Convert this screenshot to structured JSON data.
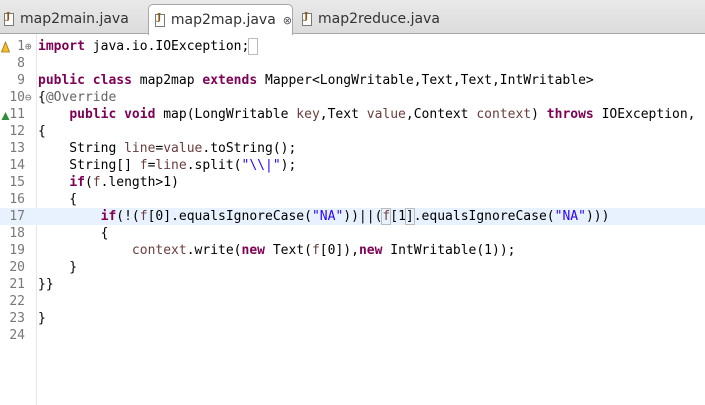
{
  "tabs": [
    {
      "label": "map2main.java",
      "active": false
    },
    {
      "label": "map2map.java",
      "active": true,
      "close": "⊗"
    },
    {
      "label": "map2reduce.java",
      "active": false
    }
  ],
  "lines": [
    {
      "num": "1",
      "fold": "⊕",
      "html": "<span class='kw'>import</span> java.io.IOException;<span class='caretbox'> </span>"
    },
    {
      "num": "8",
      "html": ""
    },
    {
      "num": "9",
      "html": "<span class='kw'>public class</span> map2map <span class='kw'>extends</span> Mapper&lt;LongWritable,Text,Text,IntWritable&gt;"
    },
    {
      "num": "10",
      "fold": "⊖",
      "html": "{<span class='ann'>@Override</span>"
    },
    {
      "num": "11",
      "html": "    <span class='kw'>public void</span> map(LongWritable <span class='fld'>key</span>,Text <span class='fld'>value</span>,Context <span class='fld'>context</span>) <span class='kw'>throws</span> IOException,"
    },
    {
      "num": "12",
      "html": "{"
    },
    {
      "num": "13",
      "html": "    String <span class='fld'>line</span>=<span class='fld'>value</span>.toString();"
    },
    {
      "num": "14",
      "html": "    String[] <span class='fld'>f</span>=<span class='fld'>line</span>.split(<span class='str'>\"\\\\|\"</span>);"
    },
    {
      "num": "15",
      "html": "    <span class='kw'>if</span>(<span class='fld'>f</span>.length&gt;1)"
    },
    {
      "num": "16",
      "html": "    {"
    },
    {
      "num": "17",
      "hl": true,
      "html": "        <span class='kw'>if</span>(!(<span class='fld'>f</span>[0].equalsIgnoreCase(<span class='str'>\"NA\"</span>))||(<span class='fld caretbox'>f</span>[1<span class='caretbox'>]</span>.equalsIgnoreCase(<span class='str'>\"NA\"</span>)))"
    },
    {
      "num": "18",
      "html": "        {"
    },
    {
      "num": "19",
      "html": "            <span class='fld'>context</span>.write(<span class='kw'>new</span> Text(<span class='fld'>f</span>[0]),<span class='kw'>new</span> IntWritable(1));"
    },
    {
      "num": "20",
      "html": "    }"
    },
    {
      "num": "21",
      "html": "}}"
    },
    {
      "num": "22",
      "html": ""
    },
    {
      "num": "23",
      "html": "}"
    },
    {
      "num": "24",
      "html": ""
    }
  ],
  "colors": {
    "keyword": "#7f0055",
    "string": "#2a00ff",
    "field": "#6a3e3e",
    "annotation": "#646464",
    "highlight": "#e8f2fe"
  },
  "icons": {
    "line1": "warning-icon",
    "line11": "override-triangle-icon"
  }
}
